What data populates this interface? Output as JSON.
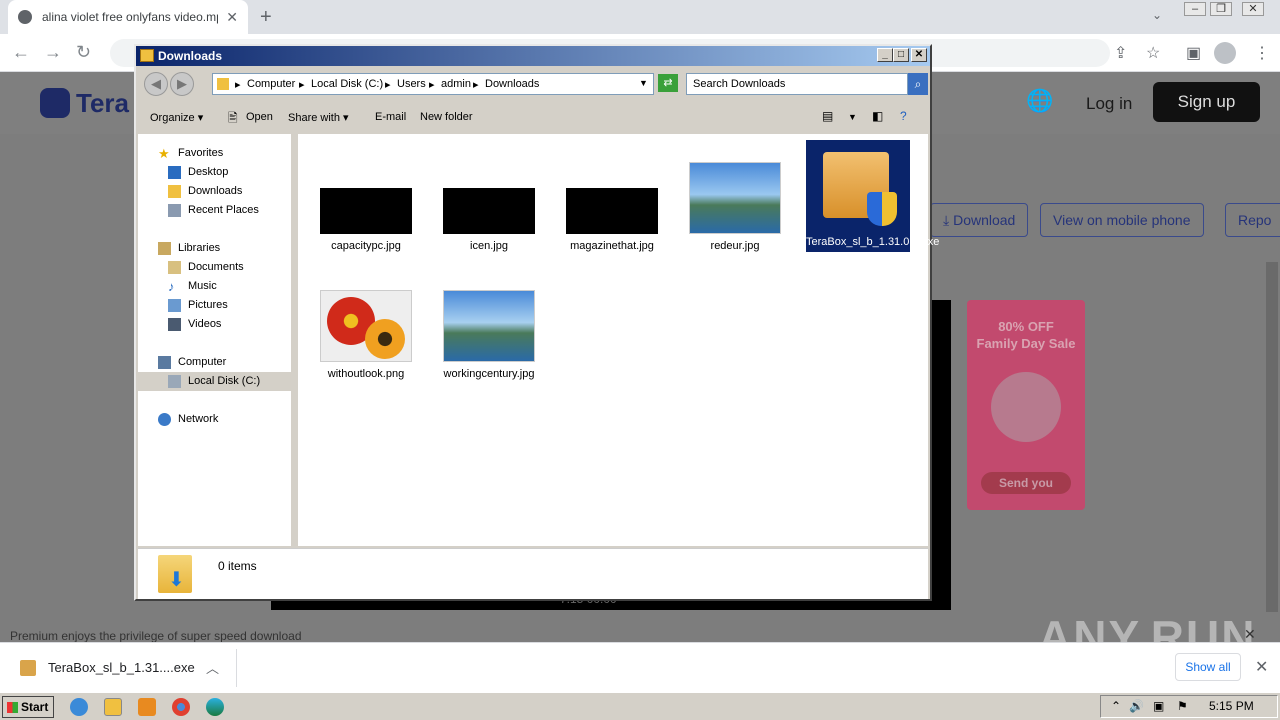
{
  "browser": {
    "tab_title": "alina violet free onlyfans video.mp4",
    "tab_close": "✕",
    "new_tab": "+"
  },
  "page": {
    "logo_text": "Tera",
    "login": "Log in",
    "signup": "Sign up",
    "download_btn": "Download",
    "mobile_btn": "View on mobile phone",
    "report_btn": "Repo",
    "ad_title": "80% OFF\nFamily Day Sale",
    "ad_button": "Send you",
    "premium_text": "Premium enjoys the privilege of super speed download",
    "video_time": "7:15    00:00"
  },
  "download_bar": {
    "file_name": "TeraBox_sl_b_1.31....exe",
    "show_all": "Show all"
  },
  "watermark": "ANY.RUN",
  "taskbar": {
    "start": "Start",
    "clock": "5:15 PM"
  },
  "explorer": {
    "title": "Downloads",
    "breadcrumb": [
      "Computer",
      "Local Disk (C:)",
      "Users",
      "admin",
      "Downloads"
    ],
    "search_placeholder": "Search Downloads",
    "commands": {
      "organize": "Organize",
      "open": "Open",
      "share_with": "Share with",
      "email": "E-mail",
      "new_folder": "New folder"
    },
    "nav": {
      "favorites": "Favorites",
      "desktop": "Desktop",
      "downloads": "Downloads",
      "recent_places": "Recent Places",
      "libraries": "Libraries",
      "documents": "Documents",
      "music": "Music",
      "pictures": "Pictures",
      "videos": "Videos",
      "computer": "Computer",
      "local_disk": "Local Disk (C:)",
      "network": "Network"
    },
    "files": [
      {
        "name": "capacitypc.jpg",
        "thumb": "black"
      },
      {
        "name": "icen.jpg",
        "thumb": "black"
      },
      {
        "name": "magazinethat.jpg",
        "thumb": "black"
      },
      {
        "name": "redeur.jpg",
        "thumb": "landscape"
      },
      {
        "name": "TeraBox_sl_b_1.31.0.1.exe",
        "thumb": "installer",
        "selected": true
      },
      {
        "name": "withoutlook.png",
        "thumb": "flowers"
      },
      {
        "name": "workingcentury.jpg",
        "thumb": "landscape"
      }
    ],
    "status": "0 items"
  }
}
